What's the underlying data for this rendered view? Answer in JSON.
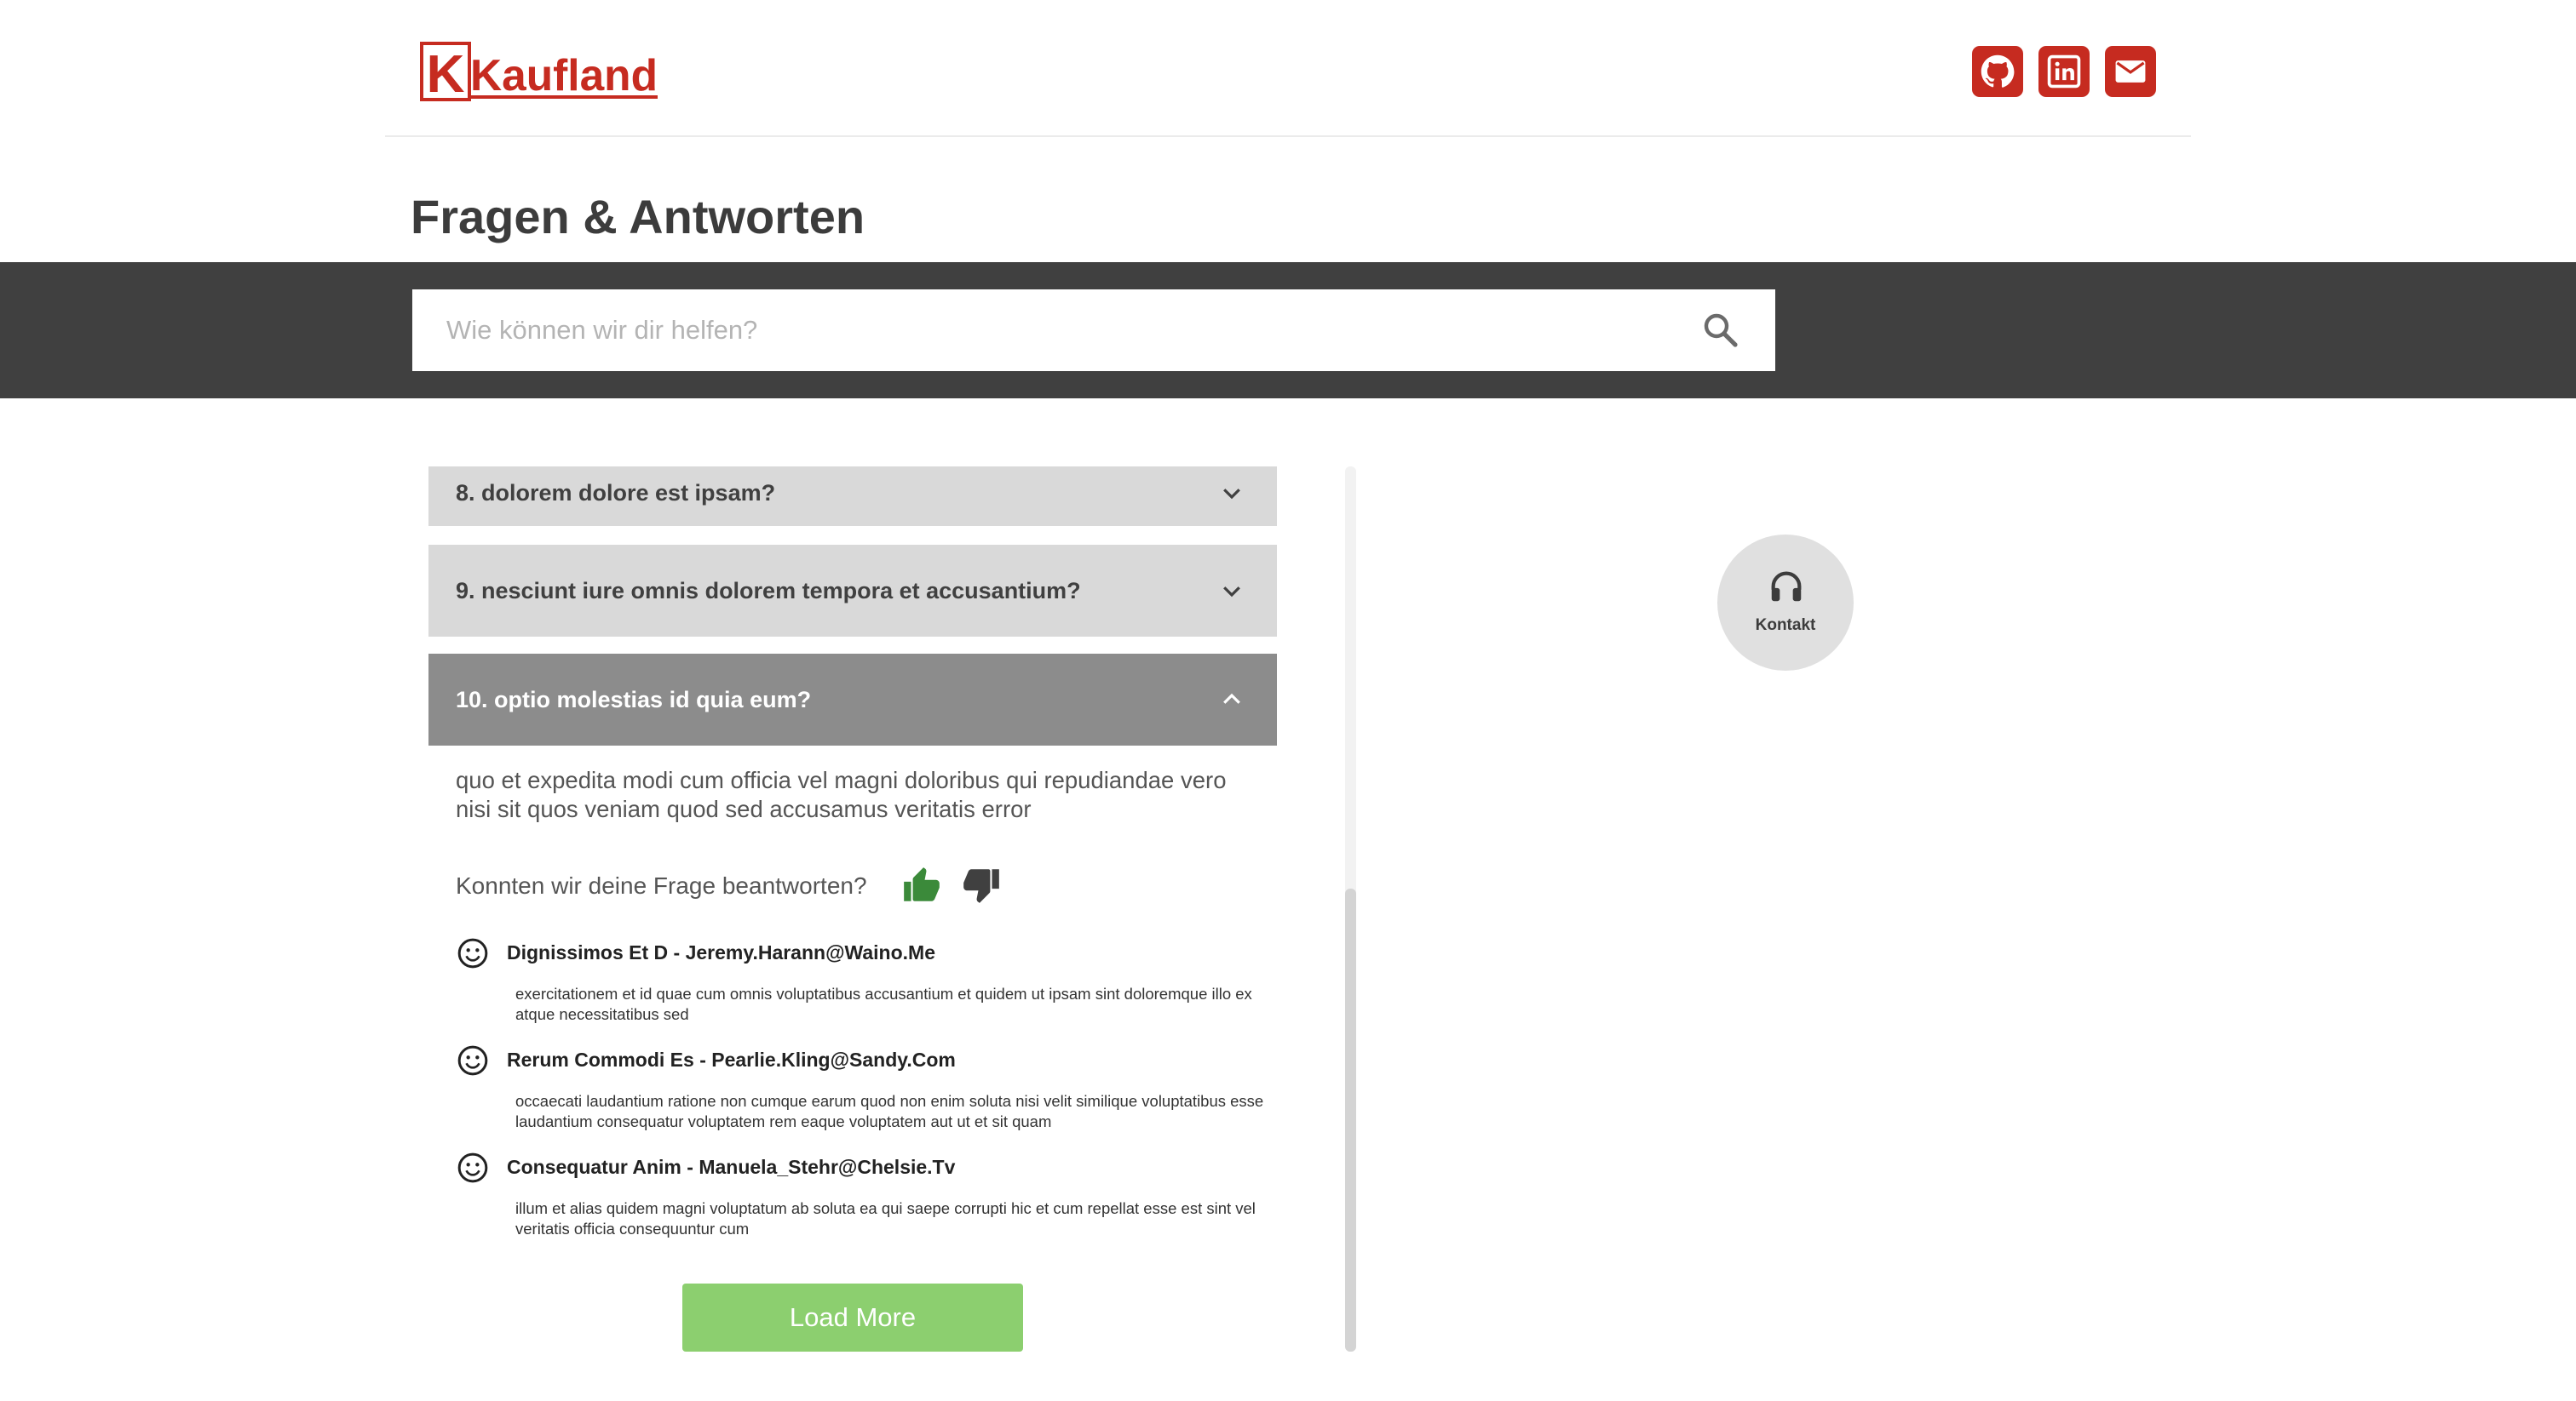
{
  "brand": {
    "logo_text": "Kaufland",
    "logo_letter": "K",
    "color": "#c62b20"
  },
  "social": [
    {
      "name": "github-icon",
      "label": "GitHub"
    },
    {
      "name": "linkedin-icon",
      "label": "LinkedIn"
    },
    {
      "name": "mail-icon",
      "label": "E-Mail"
    }
  ],
  "page": {
    "title": "Fragen & Antworten"
  },
  "search": {
    "placeholder": "Wie können wir dir helfen?",
    "value": "",
    "icon": "search-icon"
  },
  "faq": {
    "items": [
      {
        "question": "8. dolorem dolore est ipsam?",
        "expanded": false
      },
      {
        "question": "9. nesciunt iure omnis dolorem tempora et accusantium?",
        "expanded": false
      },
      {
        "question": "10. optio molestias id quia eum?",
        "expanded": true
      }
    ],
    "answer": "quo et expedita modi cum officia vel magni doloribus qui repudiandae vero nisi sit quos veniam quod sed accusamus veritatis error",
    "feedback": {
      "question": "Konnten wir deine Frage beantworten?",
      "up_icon": "thumbs-up-icon",
      "down_icon": "thumbs-down-icon",
      "up_color": "#3b8a3a",
      "down_color": "#404040"
    },
    "comments": [
      {
        "author": "Dignissimos Et D - Jeremy.Harann@Waino.Me",
        "body": "exercitationem et id quae cum omnis voluptatibus accusantium et quidem ut ipsam sint doloremque illo ex atque necessitatibus sed"
      },
      {
        "author": "Rerum Commodi Es - Pearlie.Kling@Sandy.Com",
        "body": "occaecati laudantium ratione non cumque earum quod non enim soluta nisi velit similique voluptatibus esse laudantium consequatur voluptatem rem eaque voluptatem aut ut et sit quam"
      },
      {
        "author": "Consequatur Anim - Manuela_Stehr@Chelsie.Tv",
        "body": "illum et alias quidem magni voluptatum ab soluta ea qui saepe corrupti hic et cum repellat esse est sint vel veritatis officia consequuntur cum"
      }
    ],
    "load_more_label": "Load More",
    "load_more_color": "#8ccf6f"
  },
  "contact": {
    "label": "Kontakt",
    "icon": "headset-icon"
  }
}
